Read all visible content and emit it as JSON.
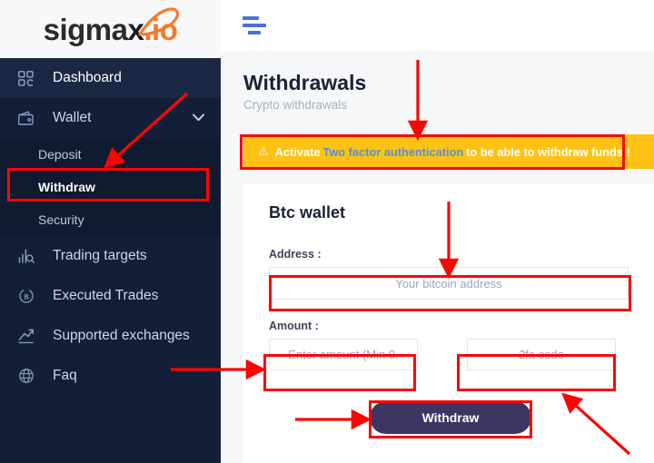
{
  "brand": {
    "name_part1": "sigma",
    "name_x": "x",
    "name_dot": ".io",
    "accent_color": "#f47b2a"
  },
  "topbar": {
    "menu_icon": "hamburger-icon"
  },
  "sidebar": {
    "background_color": "#131f38",
    "items": [
      {
        "label": "Dashboard",
        "icon": "grid-icon",
        "active": true
      },
      {
        "label": "Wallet",
        "icon": "wallet-icon",
        "chevron": "⌄",
        "expanded": true
      },
      {
        "label": "Trading targets",
        "icon": "bar-chart-search-icon"
      },
      {
        "label": "Executed Trades",
        "icon": "bitcoin-refresh-icon"
      },
      {
        "label": "Supported exchanges",
        "icon": "trend-up-icon"
      },
      {
        "label": "Faq",
        "icon": "globe-icon"
      }
    ],
    "submenu": [
      {
        "label": "Deposit",
        "selected": false
      },
      {
        "label": "Withdraw",
        "selected": true
      },
      {
        "label": "Security",
        "selected": false
      }
    ]
  },
  "page": {
    "title": "Withdrawals",
    "subtitle": "Crypto withdrawals"
  },
  "alert": {
    "icon": "warning-triangle-icon",
    "text_before": "Activate",
    "link_text": "Two factor authentication",
    "text_after": "to be able to withdraw funds !",
    "background_color": "#fdc214",
    "link_color": "#5b8ed6"
  },
  "wallet_card": {
    "title": "Btc wallet",
    "address_label": "Address :",
    "address_placeholder": "Your bitcoin address",
    "address_value": "",
    "amount_label": "Amount :",
    "amount_placeholder": "Enter amount (Min 0.",
    "amount_value": "",
    "tfa_placeholder": "2fa code",
    "tfa_value": "",
    "submit_label": "Withdraw",
    "submit_color": "#3d3663"
  },
  "annotations": {
    "color": "#fb0505",
    "highlight_boxes": [
      "withdraw-menu-item",
      "two-factor-alert",
      "address-input",
      "amount-input",
      "tfa-input",
      "withdraw-button"
    ],
    "arrows": [
      "arrow-to-withdraw-menu",
      "arrow-to-alert",
      "arrow-to-address-input",
      "arrow-to-amount-input",
      "arrow-to-withdraw-button",
      "arrow-to-tfa-input"
    ]
  }
}
